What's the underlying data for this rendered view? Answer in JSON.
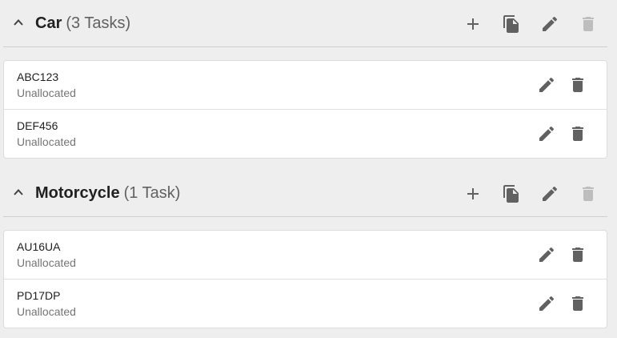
{
  "colors": {
    "background": "#eeeeee",
    "card": "#ffffff",
    "icon": "#616161",
    "icon_disabled": "#bdbdbd",
    "divider": "#cfcfcf",
    "secondary_text": "#757575"
  },
  "groups": [
    {
      "name": "Car",
      "count_label": "(3 Tasks)",
      "expanded": true,
      "header_actions": [
        "plus-icon",
        "copy-icon",
        "pencil-icon",
        "trash-icon"
      ],
      "delete_disabled": true,
      "tasks": [
        {
          "id": "ABC123",
          "status": "Unallocated"
        },
        {
          "id": "DEF456",
          "status": "Unallocated"
        }
      ]
    },
    {
      "name": "Motorcycle",
      "count_label": "(1 Task)",
      "expanded": true,
      "header_actions": [
        "plus-icon",
        "copy-icon",
        "pencil-icon",
        "trash-icon"
      ],
      "delete_disabled": true,
      "tasks": [
        {
          "id": "AU16UA",
          "status": "Unallocated"
        },
        {
          "id": "PD17DP",
          "status": "Unallocated"
        }
      ]
    }
  ]
}
